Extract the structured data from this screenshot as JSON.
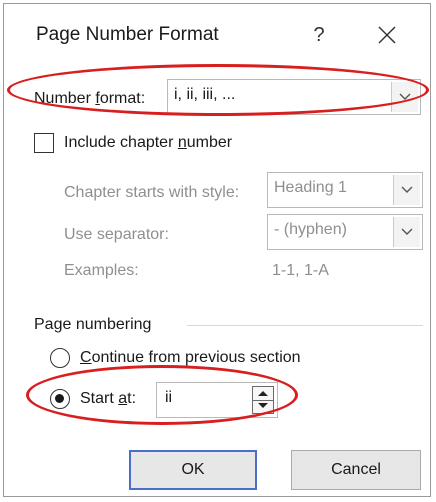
{
  "dialog": {
    "title": "Page Number Format",
    "help_label": "?"
  },
  "number_format": {
    "label_prefix": "Number ",
    "label_accel": "f",
    "label_suffix": "ormat:",
    "value": "i, ii, iii, ..."
  },
  "include_chapter": {
    "label_prefix": "Include chapter ",
    "label_accel": "n",
    "label_suffix": "umber",
    "checked": false
  },
  "chapter_style": {
    "label": "Chapter starts with style:",
    "value": "Heading 1"
  },
  "separator": {
    "label": "Use separator:",
    "value": "-   (hyphen)"
  },
  "examples": {
    "label": "Examples:",
    "value": "1-1, 1-A"
  },
  "page_numbering": {
    "section_label": "Page numbering",
    "continue_prefix": "",
    "continue_accel": "C",
    "continue_suffix": "ontinue from previous section",
    "start_prefix": "Start ",
    "start_accel": "a",
    "start_suffix": "t:",
    "start_value": "ii",
    "selected": "start_at"
  },
  "buttons": {
    "ok": "OK",
    "cancel": "Cancel"
  },
  "colors": {
    "highlight_oval": "#d81e1e",
    "default_button_border": "#4b6fc7"
  }
}
